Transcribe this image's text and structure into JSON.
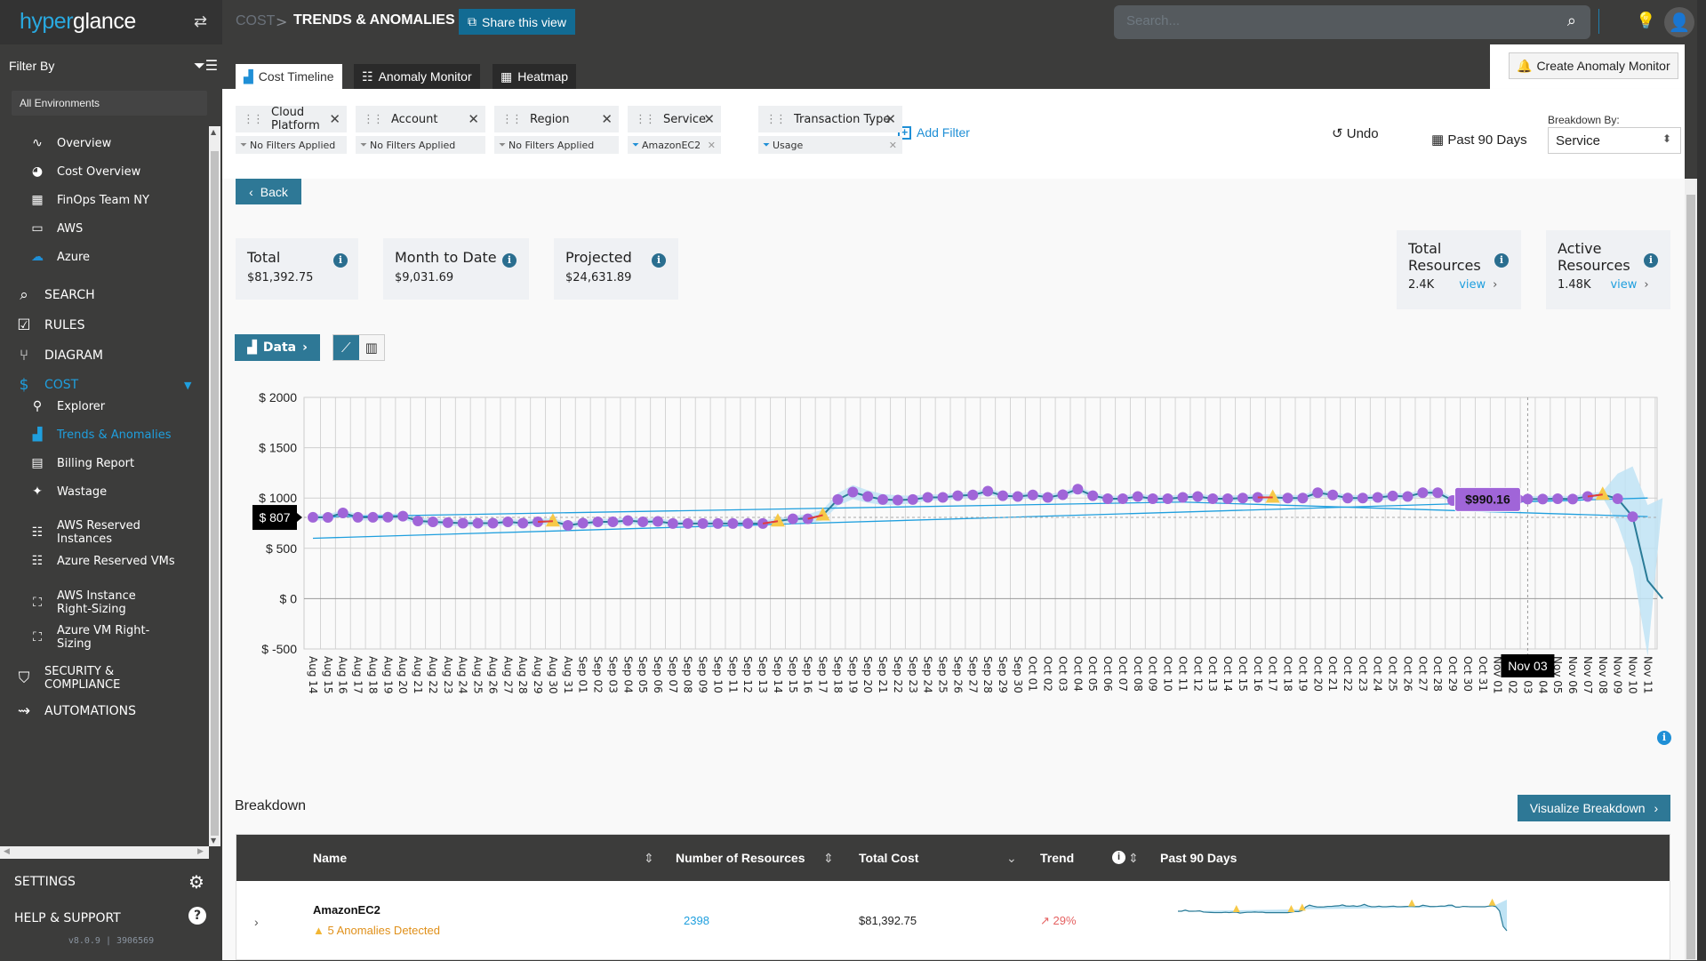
{
  "app": {
    "brand_part1": "hyper",
    "brand_part2": "glance"
  },
  "breadcrumb": {
    "parent": "COST",
    "separator": ">",
    "current": "TRENDS & ANOMALIES"
  },
  "share_label": "Share this view",
  "search": {
    "placeholder": "Search..."
  },
  "sidebar": {
    "filter_by": "Filter By",
    "environment": "All Environments",
    "items": [
      {
        "label": "Overview",
        "icon": "pulse-icon",
        "glyph": "∿",
        "level": "sub"
      },
      {
        "label": "Cost Overview",
        "icon": "pie-chart-icon",
        "glyph": "◕",
        "level": "sub"
      },
      {
        "label": "FinOps Team NY",
        "icon": "dashboard-icon",
        "glyph": "▦",
        "level": "sub"
      },
      {
        "label": "AWS",
        "icon": "aws-icon",
        "glyph": "▭",
        "level": "sub"
      },
      {
        "label": "Azure",
        "icon": "azure-cloud-icon",
        "glyph": "☁",
        "level": "sub"
      },
      {
        "label": "SEARCH",
        "icon": "search-icon",
        "glyph": "⌕",
        "level": "top"
      },
      {
        "label": "RULES",
        "icon": "rules-icon",
        "glyph": "☑",
        "level": "top"
      },
      {
        "label": "DIAGRAM",
        "icon": "diagram-icon",
        "glyph": "⑂",
        "level": "top"
      },
      {
        "label": "COST",
        "icon": "dollar-icon",
        "glyph": "$",
        "level": "top",
        "active": true
      },
      {
        "label": "Explorer",
        "icon": "explorer-icon",
        "glyph": "⚲",
        "level": "sub"
      },
      {
        "label": "Trends & Anomalies",
        "icon": "trend-chart-icon",
        "glyph": "▟",
        "level": "sub",
        "active": true
      },
      {
        "label": "Billing Report",
        "icon": "billing-report-icon",
        "glyph": "▤",
        "level": "sub"
      },
      {
        "label": "Wastage",
        "icon": "sparkle-icon",
        "glyph": "✦",
        "level": "sub"
      },
      {
        "label": "AWS Reserved Instances",
        "icon": "reserved-icon",
        "glyph": "☷",
        "level": "sub"
      },
      {
        "label": "Azure Reserved VMs",
        "icon": "reserved-icon",
        "glyph": "☷",
        "level": "sub"
      },
      {
        "label": "AWS Instance Right-Sizing",
        "icon": "resize-icon",
        "glyph": "⛶",
        "level": "sub"
      },
      {
        "label": "Azure VM Right-Sizing",
        "icon": "resize-icon",
        "glyph": "⛶",
        "level": "sub"
      },
      {
        "label": "SECURITY & COMPLIANCE",
        "icon": "shield-icon",
        "glyph": "⛉",
        "level": "top"
      },
      {
        "label": "AUTOMATIONS",
        "icon": "automation-icon",
        "glyph": "⇝",
        "level": "top"
      }
    ],
    "settings": "SETTINGS",
    "help": "HELP & SUPPORT",
    "version": "v8.0.9 | 3906569"
  },
  "tabs": [
    {
      "label": "Cost Timeline",
      "active": true
    },
    {
      "label": "Anomaly Monitor"
    },
    {
      "label": "Heatmap"
    }
  ],
  "create_monitor": "Create Anomaly Monitor",
  "filters": [
    {
      "name": "Cloud Platform",
      "value": "No Filters Applied",
      "applied": false
    },
    {
      "name": "Account",
      "value": "No Filters Applied",
      "applied": false
    },
    {
      "name": "Region",
      "value": "No Filters Applied",
      "applied": false
    },
    {
      "name": "Service",
      "value": "AmazonEC2",
      "applied": true
    },
    {
      "name": "Transaction Type",
      "value": "Usage",
      "applied": true
    }
  ],
  "add_filter": "Add Filter",
  "undo": "Undo",
  "period": "Past 90 Days",
  "breakdown_by": {
    "label": "Breakdown By:",
    "value": "Service"
  },
  "back": "Back",
  "stats": {
    "total": {
      "label": "Total",
      "value": "$81,392.75"
    },
    "mtd": {
      "label": "Month to Date",
      "value": "$9,031.69"
    },
    "projected": {
      "label": "Projected",
      "value": "$24,631.89"
    },
    "total_resources": {
      "label1": "Total",
      "label2": "Resources",
      "value": "2.4K",
      "link": "view"
    },
    "active_resources": {
      "label1": "Active",
      "label2": "Resources",
      "value": "1.48K",
      "link": "view"
    }
  },
  "data_button": "Data",
  "chart_data": {
    "type": "line",
    "title": "",
    "xlabel": "",
    "ylabel": "",
    "ylim": [
      -500,
      2000
    ],
    "yticks": [
      2000,
      1500,
      1000,
      500,
      0,
      -500
    ],
    "ytick_labels": [
      "$ 2000",
      "$ 1500",
      "$ 1000",
      "$ 500",
      "$ 0",
      "$ -500"
    ],
    "x": [
      "Aug 14",
      "Aug 15",
      "Aug 16",
      "Aug 17",
      "Aug 18",
      "Aug 19",
      "Aug 20",
      "Aug 21",
      "Aug 22",
      "Aug 23",
      "Aug 24",
      "Aug 25",
      "Aug 26",
      "Aug 27",
      "Aug 28",
      "Aug 29",
      "Aug 30",
      "Aug 31",
      "Sep 01",
      "Sep 02",
      "Sep 03",
      "Sep 04",
      "Sep 05",
      "Sep 06",
      "Sep 07",
      "Sep 08",
      "Sep 09",
      "Sep 10",
      "Sep 11",
      "Sep 12",
      "Sep 13",
      "Sep 14",
      "Sep 15",
      "Sep 16",
      "Sep 17",
      "Sep 18",
      "Sep 19",
      "Sep 20",
      "Sep 21",
      "Sep 22",
      "Sep 23",
      "Sep 24",
      "Sep 25",
      "Sep 26",
      "Sep 27",
      "Sep 28",
      "Sep 29",
      "Sep 30",
      "Oct 01",
      "Oct 02",
      "Oct 03",
      "Oct 04",
      "Oct 05",
      "Oct 06",
      "Oct 07",
      "Oct 08",
      "Oct 09",
      "Oct 10",
      "Oct 11",
      "Oct 12",
      "Oct 13",
      "Oct 14",
      "Oct 15",
      "Oct 16",
      "Oct 17",
      "Oct 18",
      "Oct 19",
      "Oct 20",
      "Oct 21",
      "Oct 22",
      "Oct 23",
      "Oct 24",
      "Oct 25",
      "Oct 26",
      "Oct 27",
      "Oct 28",
      "Oct 29",
      "Oct 30",
      "Oct 31",
      "Nov 01",
      "Nov 02",
      "Nov 03",
      "Nov 04",
      "Nov 05",
      "Nov 06",
      "Nov 07",
      "Nov 08",
      "Nov 09",
      "Nov 10",
      "Nov 11"
    ],
    "series": [
      {
        "name": "Cost",
        "values": [
          808,
          807,
          852,
          808,
          808,
          810,
          820,
          772,
          763,
          756,
          750,
          750,
          750,
          763,
          750,
          763,
          770,
          728,
          750,
          763,
          763,
          775,
          763,
          768,
          747,
          747,
          747,
          747,
          747,
          747,
          747,
          770,
          793,
          793,
          830,
          985,
          1059,
          1015,
          985,
          980,
          985,
          1006,
          1006,
          1023,
          1030,
          1068,
          1023,
          1015,
          1030,
          1006,
          1033,
          1088,
          1023,
          993,
          993,
          1015,
          993,
          993,
          1006,
          1015,
          993,
          993,
          1000,
          1006,
          1006,
          1000,
          1000,
          1053,
          1030,
          1000,
          1000,
          1006,
          1020,
          1015,
          1053,
          1053,
          975,
          975,
          1006,
          1000,
          990.16,
          990,
          990,
          993,
          990,
          1015,
          1035,
          993,
          814,
          180,
          0
        ]
      }
    ],
    "anomalies": [
      "Aug 30",
      "Sep 14",
      "Sep 17",
      "Oct 17",
      "Nov 08"
    ],
    "reference_line": {
      "label": "$ 807",
      "value": 807
    },
    "hover": {
      "x": "Nov 03",
      "value": "$990.16"
    },
    "grid": true,
    "legend": "none"
  },
  "breakdown": {
    "title": "Breakdown",
    "visualize": "Visualize Breakdown",
    "columns": [
      "Name",
      "Number of Resources",
      "Total Cost",
      "Trend",
      "Past 90 Days"
    ],
    "rows": [
      {
        "name": "AmazonEC2",
        "anomalies": "5 Anomalies Detected",
        "resources": "2398",
        "total_cost": "$81,392.75",
        "trend": "29%"
      }
    ]
  }
}
